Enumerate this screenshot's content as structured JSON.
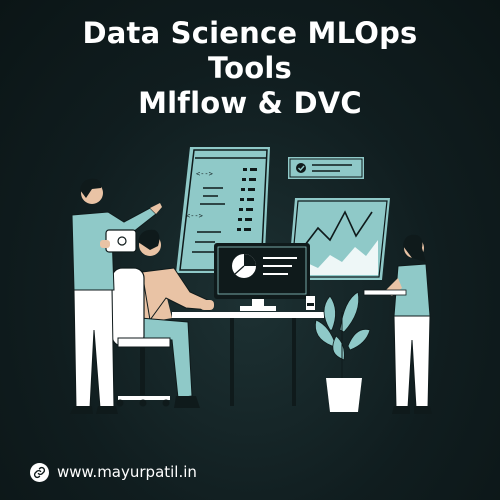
{
  "title": {
    "line1": "Data Science MLOps",
    "line2": "Tools",
    "line3": "Mlflow & DVC"
  },
  "footer": {
    "icon": "link-icon",
    "url_text": "www.mayurpatil.in"
  },
  "colors": {
    "background": "#101d1f",
    "teal": "#8fc9c8",
    "dark": "#0f1a1b",
    "skin": "#e9c3a5",
    "white": "#ffffff"
  },
  "illustration": {
    "icons": [
      "code-panel-icon",
      "check-card-icon",
      "area-chart-panel-icon",
      "monitor-icon",
      "pie-chart-icon",
      "tablet-icon",
      "potted-plant-icon",
      "laptop-icon"
    ]
  }
}
